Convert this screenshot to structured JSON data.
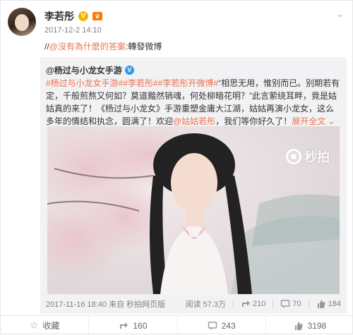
{
  "post": {
    "author": "李若彤",
    "timestamp": "2017-12-2 14:10",
    "repost_prefix": "//",
    "repost_at": "@沒有為什麽的答案",
    "repost_suffix": ":轉發微博"
  },
  "quoted": {
    "author": "@杨过与小龙女手游",
    "text_parts": {
      "t1": "#杨过与小龙女手游#",
      "t2": "#李若彤#",
      "t3": "#李若彤开微博#",
      "t4": "“相思无用，惟别而已。别期若有定，千般煎熬又何如？莫道黯然销魂，何处柳暗花明？”此言萦绕耳畔，竟是姑姑真的来了！《杨过与小龙女》手游重塑金庸大江湖，姑姑再演小龙女，这么多年的情结和执念，圆满了！欢迎",
      "t5": "@姑姑若彤",
      "t6": "，我们等你好久了！",
      "more": "展开全文",
      "more_icon": "chevron-down"
    },
    "watermark": "秒拍",
    "date_source": "2017-11-16 18:40  来自 秒拍网页版",
    "views": "阅读 57.3万",
    "shares": "210",
    "comments": "70",
    "likes": "184"
  },
  "actions": {
    "favorite": "收藏",
    "repost": "160",
    "comment": "243",
    "like": "3198"
  }
}
